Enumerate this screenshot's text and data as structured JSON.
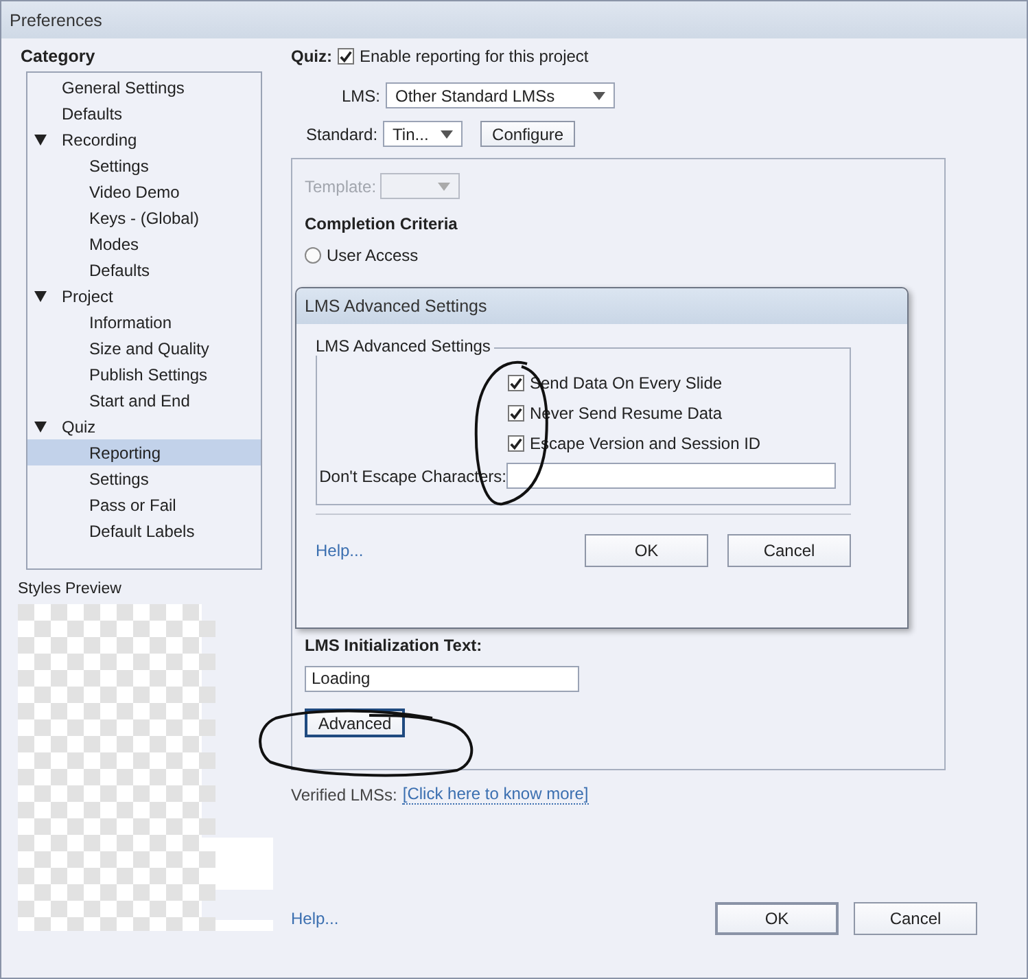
{
  "window": {
    "title": "Preferences"
  },
  "sidebar": {
    "heading": "Category",
    "items": [
      {
        "label": "General Settings",
        "selected": false
      },
      {
        "label": "Defaults",
        "selected": false
      },
      {
        "label": "Recording",
        "selected": false,
        "expanded": true,
        "children": [
          {
            "label": "Settings",
            "selected": false
          },
          {
            "label": "Video Demo",
            "selected": false
          },
          {
            "label": "Keys - (Global)",
            "selected": false
          },
          {
            "label": "Modes",
            "selected": false
          },
          {
            "label": "Defaults",
            "selected": false
          }
        ]
      },
      {
        "label": "Project",
        "selected": false,
        "expanded": true,
        "children": [
          {
            "label": "Information",
            "selected": false
          },
          {
            "label": "Size and Quality",
            "selected": false
          },
          {
            "label": "Publish Settings",
            "selected": false
          },
          {
            "label": "Start and End",
            "selected": false
          }
        ]
      },
      {
        "label": "Quiz",
        "selected": false,
        "expanded": true,
        "children": [
          {
            "label": "Reporting",
            "selected": true
          },
          {
            "label": "Settings",
            "selected": false
          },
          {
            "label": "Pass or Fail",
            "selected": false
          },
          {
            "label": "Default Labels",
            "selected": false
          }
        ]
      }
    ]
  },
  "styles_preview": {
    "label": "Styles Preview"
  },
  "quiz": {
    "label": "Quiz:",
    "enable_reporting": {
      "label": "Enable reporting for this project",
      "checked": true
    },
    "lms": {
      "label": "LMS:",
      "value": "Other Standard LMSs"
    },
    "standard": {
      "label": "Standard:",
      "value": "Tin..."
    },
    "configure_button": "Configure",
    "template": {
      "label": "Template:",
      "disabled": true
    },
    "completion_criteria": {
      "heading": "Completion Criteria",
      "options": [
        {
          "label": "User Access",
          "selected": false
        }
      ]
    },
    "lms_init_text": {
      "label": "LMS Initialization Text:",
      "value": "Loading"
    },
    "advanced_button": {
      "label": "Advanced",
      "focused": true
    },
    "verified": {
      "label": "Verified LMSs:",
      "link": "[Click here to know more]"
    }
  },
  "dialog": {
    "title": "LMS Advanced Settings",
    "group_label": "LMS Advanced Settings",
    "options": [
      {
        "label": "Send Data On Every Slide",
        "checked": true
      },
      {
        "label": "Never Send Resume Data",
        "checked": true
      },
      {
        "label": "Escape Version and Session ID",
        "checked": true
      }
    ],
    "dont_escape": {
      "label": "Don't Escape Characters:"
    },
    "help_link": "Help...",
    "buttons": [
      {
        "label": "OK"
      },
      {
        "label": "Cancel"
      }
    ]
  },
  "footer": {
    "help_link": "Help...",
    "buttons": [
      {
        "label": "OK",
        "default": true
      },
      {
        "label": "Cancel",
        "default": false
      }
    ]
  }
}
